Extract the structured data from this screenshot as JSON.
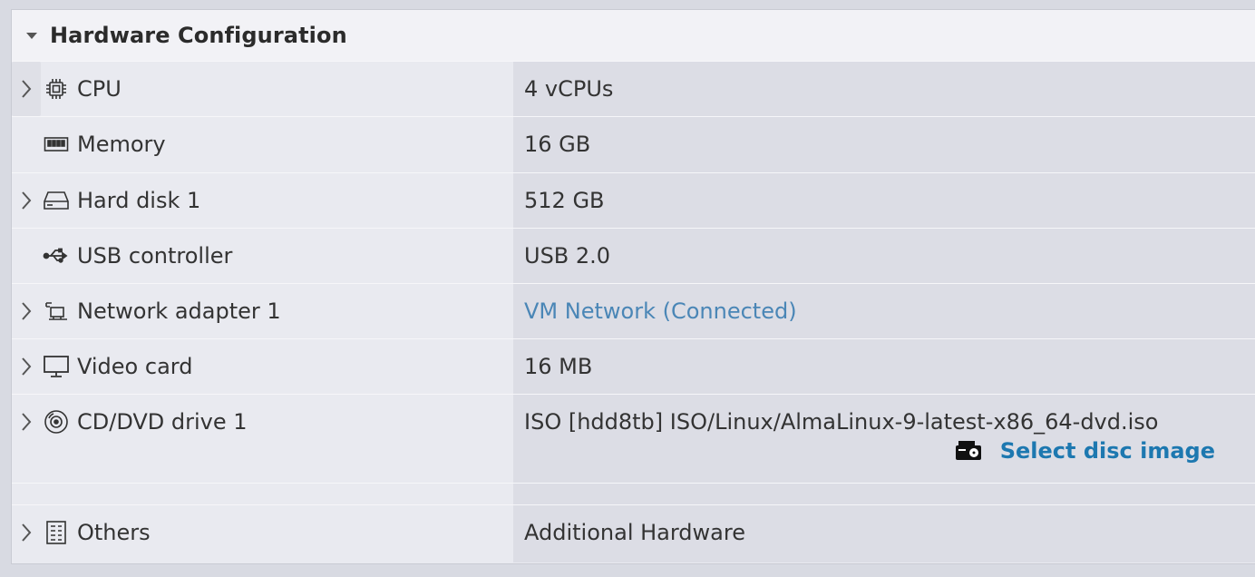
{
  "section": {
    "title": "Hardware Configuration"
  },
  "rows": [
    {
      "label": "CPU",
      "value": "4 vCPUs",
      "icon": "cpu-icon",
      "expandable": true
    },
    {
      "label": "Memory",
      "value": "16 GB",
      "icon": "memory-icon",
      "expandable": false
    },
    {
      "label": "Hard disk 1",
      "value": "512 GB",
      "icon": "hard-disk-icon",
      "expandable": true
    },
    {
      "label": "USB controller",
      "value": "USB 2.0",
      "icon": "usb-icon",
      "expandable": false
    },
    {
      "label": "Network adapter 1",
      "value": "VM Network (Connected)",
      "icon": "network-adapter-icon",
      "expandable": true
    },
    {
      "label": "Video card",
      "value": "16 MB",
      "icon": "monitor-icon",
      "expandable": true
    },
    {
      "label": "CD/DVD drive 1",
      "value": "ISO [hdd8tb] ISO/Linux/AlmaLinux-9-latest-x86_64-dvd.iso",
      "icon": "disc-icon",
      "expandable": true,
      "action": "Select disc image",
      "action_icon": "datastore-icon"
    },
    {
      "label": "Others",
      "value": "Additional Hardware",
      "icon": "others-icon",
      "expandable": true
    }
  ],
  "colors": {
    "link": "#4a86b6",
    "action_link": "#1d78b0"
  }
}
